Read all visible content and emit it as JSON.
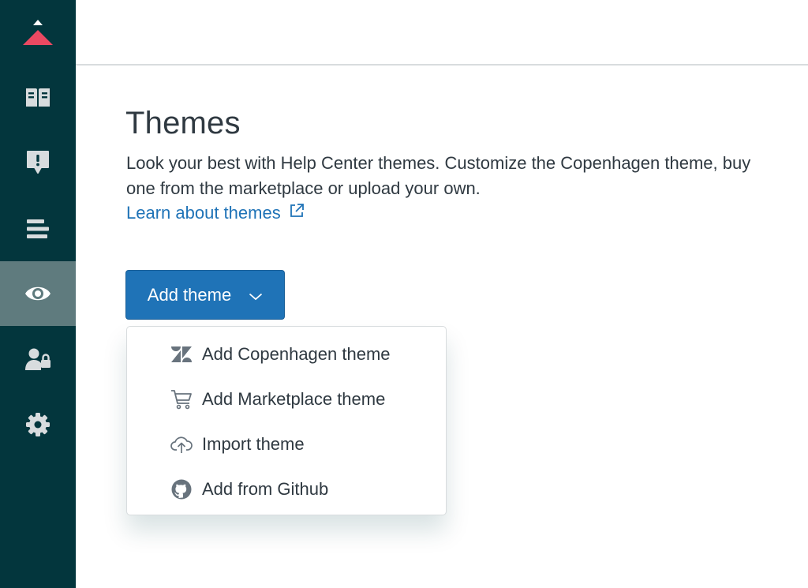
{
  "sidebar": {
    "logo_icon": "zendesk-guide-logo-icon",
    "items": [
      {
        "icon": "book-icon",
        "active": false
      },
      {
        "icon": "alert-bubble-icon",
        "active": false
      },
      {
        "icon": "align-lines-icon",
        "active": false
      },
      {
        "icon": "eye-icon",
        "active": true
      },
      {
        "icon": "user-lock-icon",
        "active": false
      },
      {
        "icon": "gear-icon",
        "active": false
      }
    ],
    "colors": {
      "background": "#03363d",
      "active": "#5f7b7e",
      "icon": "#d8dcde",
      "logo_accent": "#eb4962"
    }
  },
  "page": {
    "title": "Themes",
    "description": "Look your best with Help Center themes. Customize the Copenhagen theme, buy one from the marketplace or upload your own.",
    "learn_link": "Learn about themes",
    "learn_link_icon": "external-link-icon"
  },
  "add_theme": {
    "label": "Add theme",
    "icon": "chevron-down-icon",
    "color": "#1f73b7",
    "menu": [
      {
        "label": "Add Copenhagen theme",
        "icon": "zendesk-icon"
      },
      {
        "label": "Add Marketplace theme",
        "icon": "shopping-cart-icon"
      },
      {
        "label": "Import theme",
        "icon": "cloud-upload-icon"
      },
      {
        "label": "Add from Github",
        "icon": "github-icon"
      }
    ]
  }
}
